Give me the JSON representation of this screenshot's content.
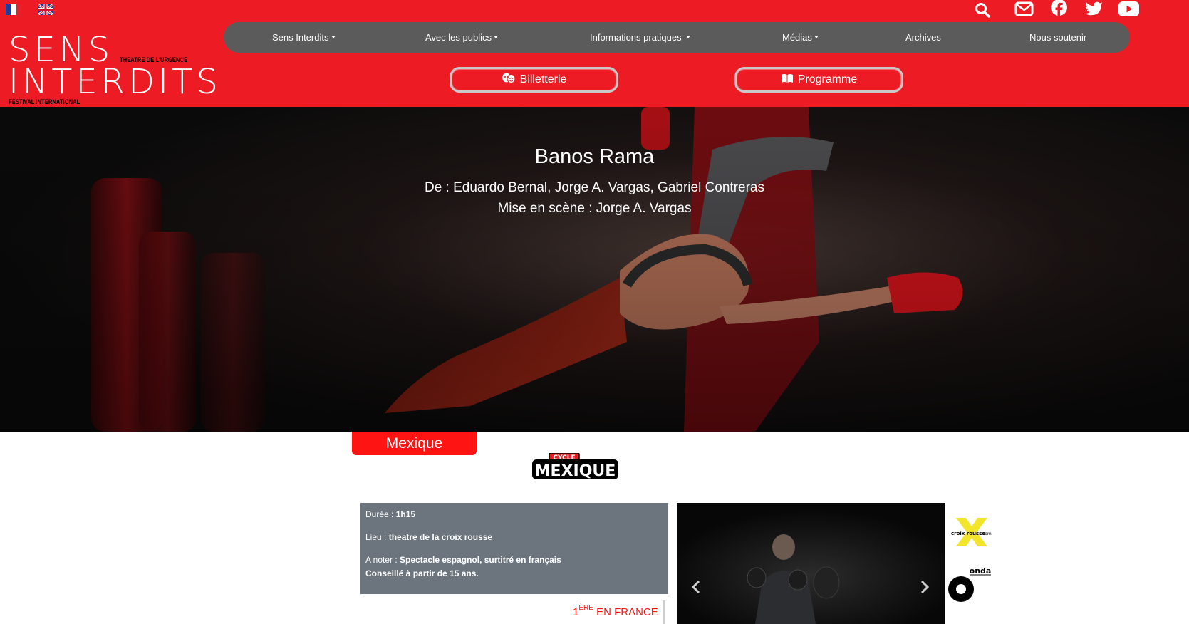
{
  "language": {
    "fr_label": "Français",
    "en_label": "English"
  },
  "logo": {
    "line1": "SENS",
    "line2": "INTERDITS",
    "tagline": "THEATRE DE L'URGENCE",
    "subtitle": "FESTIVAL INTERNATIONAL"
  },
  "nav": {
    "items": [
      {
        "label": "Sens Interdits",
        "dropdown": true
      },
      {
        "label": "Avec les publics",
        "dropdown": true
      },
      {
        "label": "Informations pratiques",
        "dropdown": true
      },
      {
        "label": "Médias",
        "dropdown": true
      },
      {
        "label": "Archives",
        "dropdown": false
      },
      {
        "label": "Nous soutenir",
        "dropdown": false
      }
    ]
  },
  "cta": {
    "tickets": "Billetterie",
    "program": "Programme"
  },
  "social": [
    "search-icon",
    "email-icon",
    "facebook-icon",
    "twitter-icon",
    "youtube-icon"
  ],
  "hero": {
    "title": "Banos Rama",
    "authors": "De : Eduardo Bernal, Jorge A. Vargas, Gabriel Contreras",
    "director": "Mise en scène : Jorge A. Vargas"
  },
  "country": "Mexique",
  "cycle_badge": {
    "top": "CYCLE",
    "bottom": "MEXIQUE"
  },
  "info": {
    "duration_label": "Durée : ",
    "duration_value": "1h15",
    "venue_label": "Lieu : ",
    "venue_value": "theatre de la croix rousse",
    "note_label": "A noter : ",
    "note_value": "Spectacle espagnol, surtitré en français",
    "note_value2": "Conseillé à partir de 15 ans."
  },
  "premiere": {
    "number": "1",
    "sup": "ÈRE",
    "text": " EN FRANCE"
  },
  "partners": {
    "croix_rousse": "croix rousse",
    "croix_rousse_suffix": ".com",
    "onda": "onda"
  },
  "colors": {
    "brand_red": "#ed1c24",
    "nav_gray": "#5b5b5b",
    "info_gray": "#6c757d",
    "accent_red": "#ff1414"
  }
}
